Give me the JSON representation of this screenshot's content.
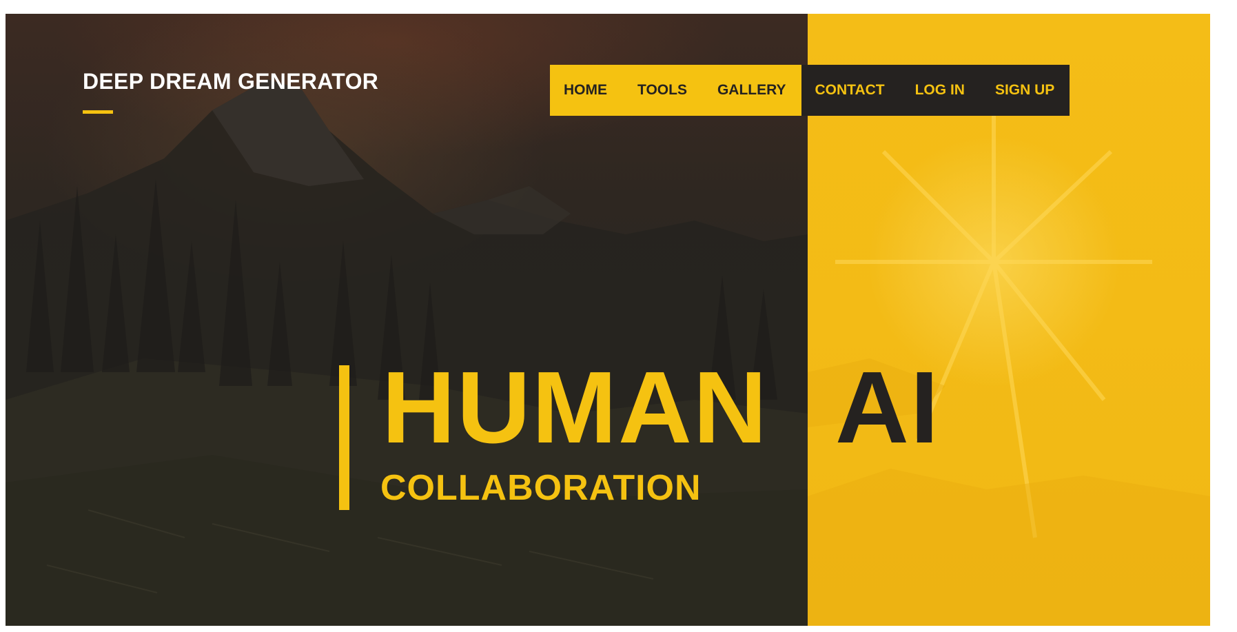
{
  "site": {
    "logo_text": "DEEP DREAM GENERATOR"
  },
  "nav": {
    "primary_items": [
      {
        "label": "HOME"
      },
      {
        "label": "TOOLS"
      },
      {
        "label": "GALLERY"
      }
    ],
    "secondary_items": [
      {
        "label": "CONTACT"
      },
      {
        "label": "LOG IN"
      },
      {
        "label": "SIGN UP"
      }
    ]
  },
  "hero": {
    "headline_left": "HUMAN",
    "headline_right": "AI",
    "subtitle": "COLLABORATION"
  },
  "colors": {
    "accent": "#f5c211",
    "dark": "#252220",
    "white": "#ffffff"
  }
}
